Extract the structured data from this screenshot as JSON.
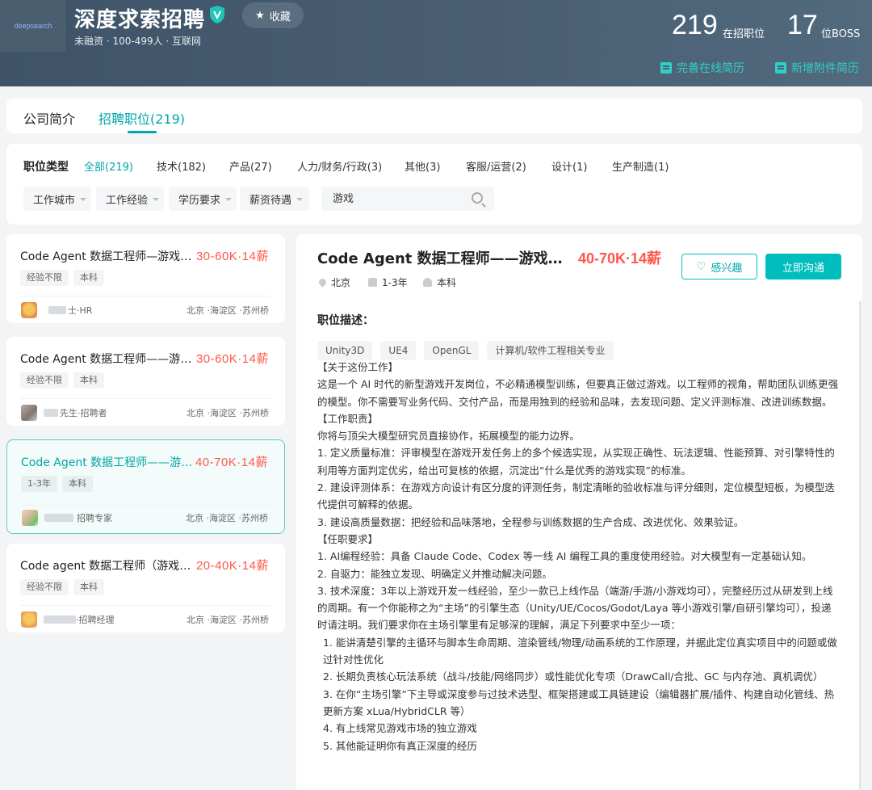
{
  "header": {
    "logo_text": "deepsearch",
    "company_name": "深度求索招聘",
    "favorite_label": "收藏",
    "company_meta": "未融资 · 100-499人 · 互联网",
    "stats": [
      {
        "num": "219",
        "unit": "在招职位"
      },
      {
        "num": "17",
        "unit": "位BOSS"
      }
    ],
    "links": {
      "improve_resume": "完善在线简历",
      "add_attachment": "新增附件简历"
    },
    "accent": "#2fd0c6"
  },
  "tabs": {
    "intro": "公司简介",
    "jobs": "招聘职位(219)"
  },
  "filters": {
    "type_label": "职位类型",
    "types": [
      "全部(219)",
      "技术(182)",
      "产品(27)",
      "人力/财务/行政(3)",
      "其他(3)",
      "客服/运营(2)",
      "设计(1)",
      "生产制造(1)"
    ],
    "dropdowns": [
      "工作城市",
      "工作经验",
      "学历要求",
      "薪资待遇"
    ],
    "search_value": "游戏"
  },
  "job_list": [
    {
      "title": "Code Agent 数据工程师—游戏开发方向",
      "salary": "30-60K·14薪",
      "tags": [
        "经验不限",
        "本科"
      ],
      "recruiter": "士·HR",
      "location": "北京 ·海淀区 ·苏州桥"
    },
    {
      "title": "Code Agent 数据工程师——游戏开发方向",
      "salary": "30-60K·14薪",
      "tags": [
        "经验不限",
        "本科"
      ],
      "recruiter": "先生·招聘者",
      "location": "北京 ·海淀区 ·苏州桥"
    },
    {
      "title": "Code Agent 数据工程师——游戏开发方向",
      "salary": "40-70K·14薪",
      "tags": [
        "1-3年",
        "本科"
      ],
      "recruiter": "招聘专家",
      "location": "北京 ·海淀区 ·苏州桥"
    },
    {
      "title": "Code agent 数据工程师（游戏开发方向）",
      "salary": "20-40K·14薪",
      "tags": [
        "经验不限",
        "本科"
      ],
      "recruiter": "·招聘经理",
      "location": "北京 ·海淀区 ·苏州桥"
    }
  ],
  "detail": {
    "title": "Code Agent 数据工程师——游戏开发方向",
    "salary": "40-70K·14薪",
    "city": "北京",
    "experience": "1-3年",
    "degree": "本科",
    "interest_label": "感兴趣",
    "chat_label": "立即沟通",
    "desc_label": "职位描述：",
    "skills": [
      "Unity3D",
      "UE4",
      "OpenGL",
      "计算机/软件工程相关专业"
    ],
    "body": [
      "【关于这份工作】",
      "这是一个 AI 时代的新型游戏开发岗位，不必精通模型训练，但要真正做过游戏。以工程师的视角，帮助团队训练更强的模型。你不需要写业务代码、交付产品，而是用独到的经验和品味，去发现问题、定义评测标准、改进训练数据。",
      "【工作职责】",
      "你将与顶尖大模型研究员直接协作，拓展模型的能力边界。",
      "1. 定义质量标准：评审模型在游戏开发任务上的多个候选实现，从实现正确性、玩法逻辑、性能预算、对引擎特性的利用等方面判定优劣，给出可复核的依据，沉淀出“什么是优秀的游戏实现”的标准。",
      "2. 建设评测体系：在游戏方向设计有区分度的评测任务，制定清晰的验收标准与评分细则，定位模型短板，为模型迭代提供可解释的依据。",
      "3. 建设高质量数据：把经验和品味落地，全程参与训练数据的生产合成、改进优化、效果验证。",
      "【任职要求】",
      "1. AI编程经验：具备 Claude Code、Codex 等一线 AI 编程工具的重度使用经验。对大模型有一定基础认知。",
      "2. 自驱力：能独立发现、明确定义并推动解决问题。",
      "3. 技术深度：3年以上游戏开发一线经验，至少一款已上线作品（端游/手游/小游戏均可），完整经历过从研发到上线的周期。有一个你能称之为“主场”的引擎生态（Unity/UE/Cocos/Godot/Laya 等小游戏引擎/自研引擎均可），投递时请注明。我们要求你在主场引擎里有足够深的理解，满足下列要求中至少一项：",
      "1. 能讲清楚引擎的主循环与脚本生命周期、渲染管线/物理/动画系统的工作原理，并据此定位真实项目中的问题或做过针对性优化",
      "2. 长期负责核心玩法系统（战斗/技能/网络同步）或性能优化专项（DrawCall/合批、GC 与内存池、真机调优）",
      "3. 在你“主场引擎”下主导或深度参与过技术选型、框架搭建或工具链建设（编辑器扩展/插件、构建自动化管线、热更新方案 xLua/HybridCLR 等）",
      "4. 有上线常见游戏市场的独立游戏",
      "5. 其他能证明你有真正深度的经历"
    ]
  }
}
